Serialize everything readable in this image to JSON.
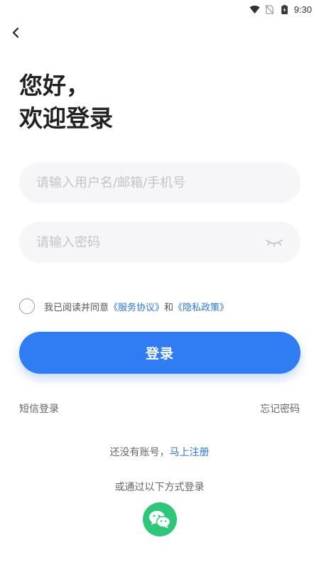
{
  "status_bar": {
    "time": "9:30"
  },
  "greeting": {
    "line1": "您好，",
    "line2": "欢迎登录"
  },
  "username": {
    "placeholder": "请输入用户名/邮箱/手机号",
    "value": ""
  },
  "password": {
    "placeholder": "请输入密码",
    "value": ""
  },
  "agreement": {
    "prefix": "我已阅读并同意",
    "service_link": "《服务协议》",
    "and": "和",
    "privacy_link": "《隐私政策》"
  },
  "login_button": {
    "label": "登录"
  },
  "sms_login": "短信登录",
  "forgot_password": "忘记密码",
  "register": {
    "prompt": "还没有账号，",
    "link": "马上注册"
  },
  "other_methods": "或通过以下方式登录",
  "colors": {
    "primary": "#2f7cf3",
    "link": "#2d74e0",
    "wechat": "#2ec77a",
    "input_bg": "#f6f6f8"
  },
  "icons": {
    "back": "chevron-left-icon",
    "password_toggle": "eye-closed-icon",
    "social": "wechat-icon"
  }
}
